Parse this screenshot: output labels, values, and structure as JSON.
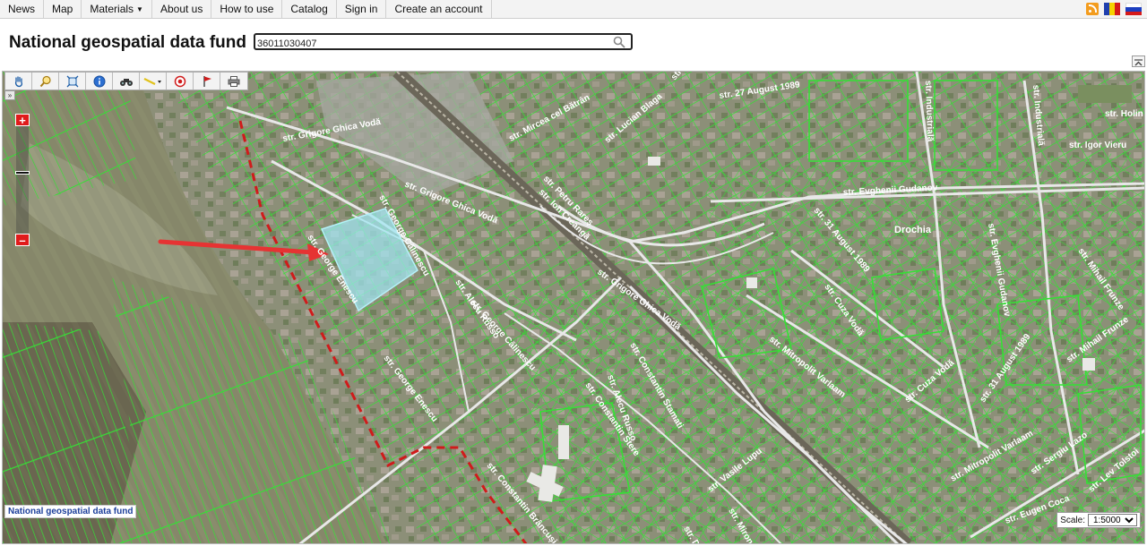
{
  "nav": {
    "items": [
      {
        "label": "News",
        "dropdown": false
      },
      {
        "label": "Map",
        "dropdown": false
      },
      {
        "label": "Materials",
        "dropdown": true
      },
      {
        "label": "About us",
        "dropdown": false
      },
      {
        "label": "How to use",
        "dropdown": false
      },
      {
        "label": "Catalog",
        "dropdown": false
      },
      {
        "label": "Sign in",
        "dropdown": false
      },
      {
        "label": "Create an account",
        "dropdown": false
      }
    ],
    "right_icons": [
      "rss-icon",
      "flag-moldova-icon",
      "flag-russia-icon"
    ]
  },
  "header": {
    "title": "National geospatial data fund",
    "search_value": "36011030407"
  },
  "map": {
    "toolbar": [
      "pan-icon",
      "zoom-box-icon",
      "full-extent-icon",
      "info-icon",
      "binoculars-icon",
      "measure-icon",
      "target-icon",
      "flag-icon",
      "print-icon"
    ],
    "attribution": "National geospatial data fund",
    "scale_label": "Scale:",
    "scale_value": "1:5000",
    "scale_options": [
      "1:5000"
    ],
    "place_label": "Drochia",
    "streets": [
      "str. Grigore Ghica Vodă",
      "str. Grigore Ghica Vodă",
      "str. Grigore Ghica Vodă",
      "str. Mircea cel Bătrân",
      "str. 27 August 1989",
      "str. Evghenii Gudanov",
      "str. Evghenii Gudanov",
      "str. Industrială",
      "str. Industrială",
      "str. Holin",
      "str. Igor Vieru",
      "str. 31 August 1989",
      "str. 31 August 1989",
      "str. Cuza Vodă",
      "str. Cuza Vodă",
      "str. Mitropolit Varlaam",
      "str. Mitropolit Varlaam",
      "str. Mihail Frunze",
      "str. Mihail Frunze",
      "str. Alecu Russo",
      "str. Alecu Russo",
      "str. George Călinescu",
      "str. George Călinescu",
      "str. George Enescu",
      "str. George Enescu",
      "str. Constantin Stere",
      "str. Constantin Stamati",
      "str. Constantin Brâncuși",
      "str. Ion Creangă",
      "str. Petru Rareș",
      "str. Lucian Blaga",
      "str. Vasile Lupu",
      "str. Miron Costin",
      "str. Dacia",
      "str. Sergiu Lazo",
      "str. Eugen Coca",
      "str. Lev Tolstoi",
      "str. Gavriil Musicescu"
    ],
    "colors": {
      "parcel": "#35e035",
      "road": "#e6e6e6",
      "highlight": "#9fe6f2",
      "arrow": "#e63333",
      "border_dash": "#d01b1b",
      "zoom": "#e01b1b"
    }
  }
}
